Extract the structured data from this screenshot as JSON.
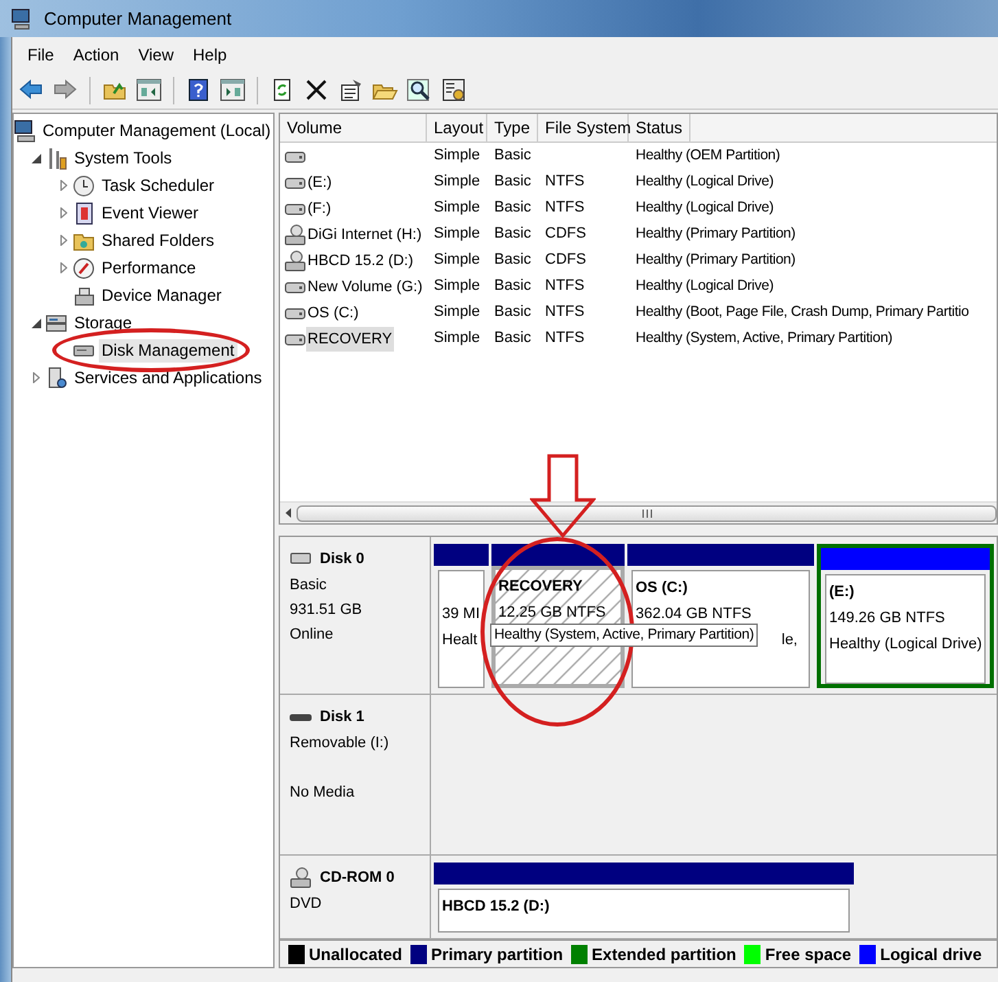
{
  "window": {
    "title": "Computer Management"
  },
  "menu": [
    "File",
    "Action",
    "View",
    "Help"
  ],
  "tree": [
    {
      "label": "Computer Management (Local)",
      "selected": false,
      "children": [
        {
          "label": "System Tools",
          "expanded": true,
          "selected": false,
          "children": [
            {
              "label": "Task Scheduler",
              "expanded": false,
              "selected": false
            },
            {
              "label": "Event Viewer",
              "expanded": false,
              "selected": false
            },
            {
              "label": "Shared Folders",
              "expanded": false,
              "selected": false
            },
            {
              "label": "Performance",
              "expanded": false,
              "selected": false
            },
            {
              "label": "Device Manager",
              "selected": false
            }
          ]
        },
        {
          "label": "Storage",
          "expanded": true,
          "selected": false,
          "children": [
            {
              "label": "Disk Management",
              "selected": true
            }
          ]
        },
        {
          "label": "Services and Applications",
          "expanded": false,
          "selected": false
        }
      ]
    }
  ],
  "volumes": {
    "columns": [
      "Volume",
      "Layout",
      "Type",
      "File System",
      "Status"
    ],
    "rows": [
      {
        "selected": false,
        "cells": [
          "",
          "Simple",
          "Basic",
          "",
          "Healthy (OEM Partition)"
        ]
      },
      {
        "selected": false,
        "cells": [
          "(E:)",
          "Simple",
          "Basic",
          "NTFS",
          "Healthy (Logical Drive)"
        ]
      },
      {
        "selected": false,
        "cells": [
          "(F:)",
          "Simple",
          "Basic",
          "NTFS",
          "Healthy (Logical Drive)"
        ]
      },
      {
        "selected": false,
        "cells": [
          "DiGi Internet (H:)",
          "Simple",
          "Basic",
          "CDFS",
          "Healthy (Primary Partition)"
        ]
      },
      {
        "selected": false,
        "cells": [
          "HBCD 15.2 (D:)",
          "Simple",
          "Basic",
          "CDFS",
          "Healthy (Primary Partition)"
        ]
      },
      {
        "selected": false,
        "cells": [
          "New Volume (G:)",
          "Simple",
          "Basic",
          "NTFS",
          "Healthy (Logical Drive)"
        ]
      },
      {
        "selected": false,
        "cells": [
          "OS (C:)",
          "Simple",
          "Basic",
          "NTFS",
          "Healthy (Boot, Page File, Crash Dump, Primary Partitio"
        ]
      },
      {
        "selected": true,
        "cells": [
          "RECOVERY",
          "Simple",
          "Basic",
          "NTFS",
          "Healthy (System, Active, Primary Partition)"
        ]
      }
    ]
  },
  "disks": [
    {
      "name": "Disk 0",
      "lines": [
        "Basic",
        "931.51 GB",
        "Online"
      ],
      "partitions": [
        {
          "kind": "primary",
          "selected": false,
          "size": "39 MI",
          "status": "Healt"
        },
        {
          "kind": "primary",
          "selected": true,
          "name": "RECOVERY",
          "size": "12.25 GB NTFS",
          "tooltip": "Healthy (System, Active, Primary Partition)"
        },
        {
          "kind": "primary",
          "selected": false,
          "name": "OS  (C:)",
          "size": "362.04 GB NTFS",
          "status": "le,"
        },
        {
          "kind": "logical",
          "selected": false,
          "name": "(E:)",
          "size": "149.26 GB NTFS",
          "status": "Healthy (Logical Drive)"
        }
      ]
    },
    {
      "name": "Disk 1",
      "lines": [
        "Removable (I:)",
        "No Media"
      ]
    },
    {
      "name": "CD-ROM 0",
      "lines": [
        "DVD"
      ],
      "partitions": [
        {
          "kind": "primary",
          "selected": false,
          "name": "HBCD 15.2  (D:)"
        }
      ]
    }
  ],
  "legend": [
    {
      "label": "Unallocated",
      "color": "#000000"
    },
    {
      "label": "Primary partition",
      "color": "#000080"
    },
    {
      "label": "Extended partition",
      "color": "#008000"
    },
    {
      "label": "Free space",
      "color": "#00ff00"
    },
    {
      "label": "Logical drive",
      "color": "#0000ff"
    }
  ]
}
